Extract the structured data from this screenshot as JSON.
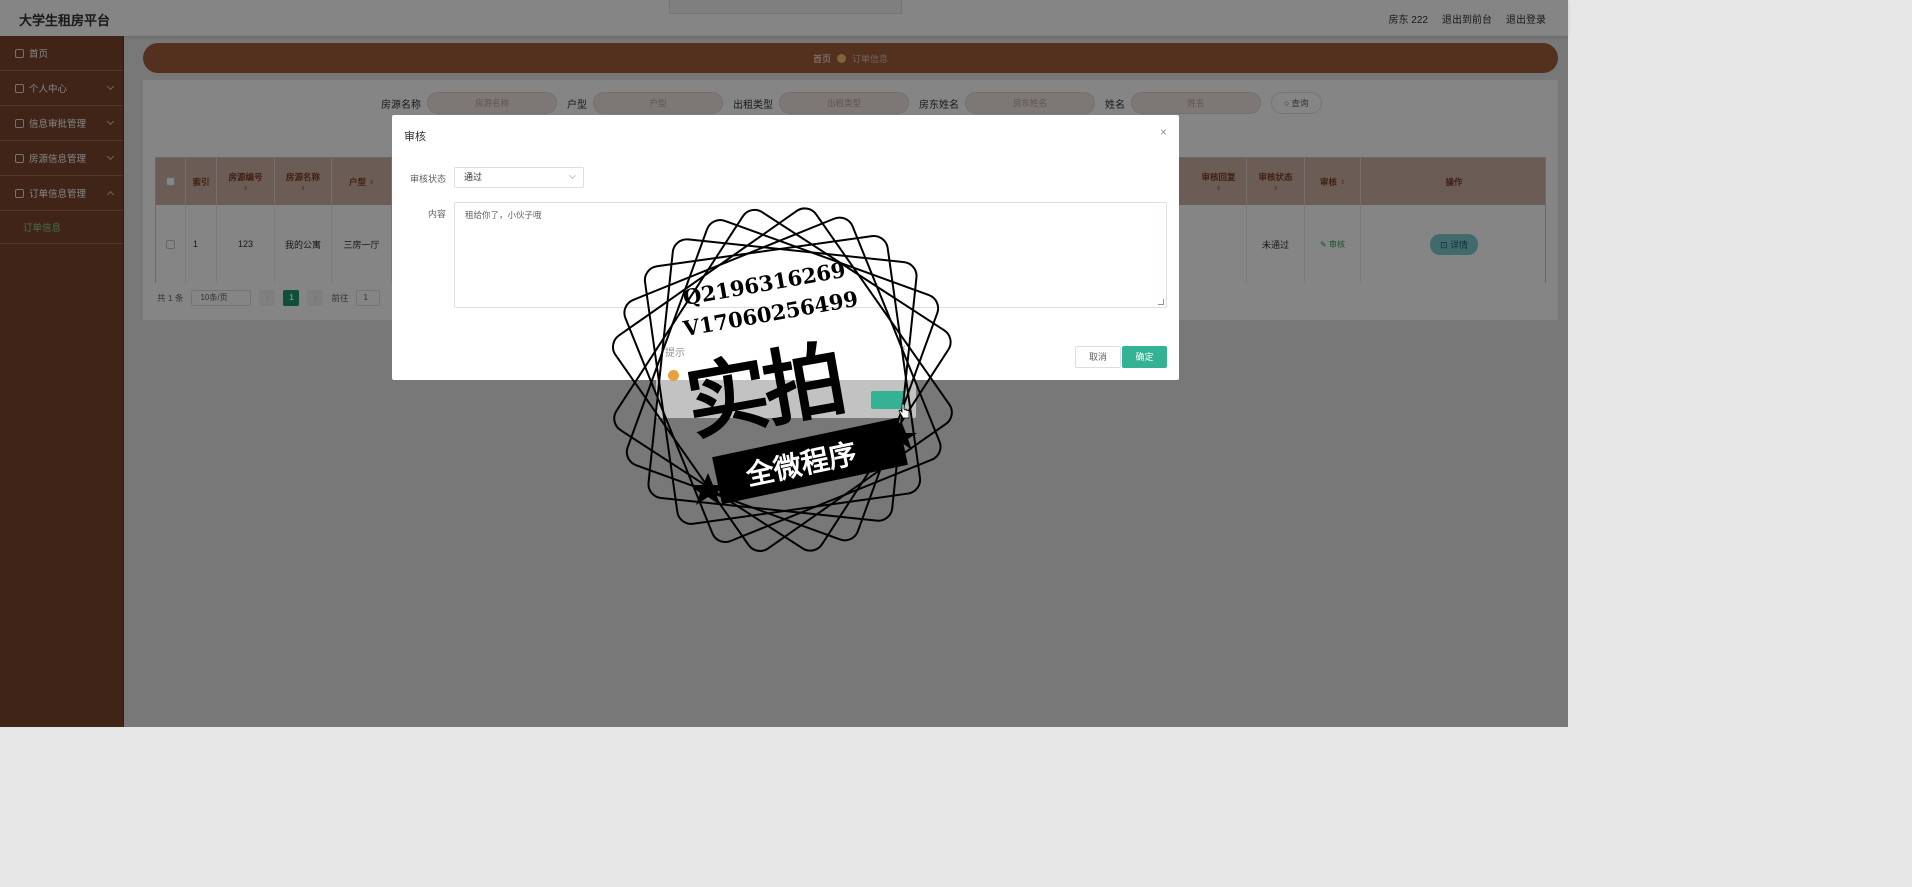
{
  "app": {
    "title": "大学生租房平台"
  },
  "topbar": {
    "user": "房东 222",
    "to_frontend": "退出到前台",
    "logout": "退出登录"
  },
  "sidebar": {
    "items": [
      {
        "label": "首页",
        "icon": "home-icon"
      },
      {
        "label": "个人中心",
        "icon": "user-icon"
      },
      {
        "label": "信息审批管理",
        "icon": "approve-icon"
      },
      {
        "label": "房源信息管理",
        "icon": "house-icon"
      },
      {
        "label": "订单信息管理",
        "icon": "order-icon"
      }
    ],
    "active_sub": "订单信息"
  },
  "breadcrumb": {
    "home": "首页",
    "current": "订单信息"
  },
  "search": {
    "fields": [
      {
        "label": "房源名称",
        "placeholder": "房源名称"
      },
      {
        "label": "户型",
        "placeholder": "户型"
      },
      {
        "label": "出租类型",
        "placeholder": "出租类型"
      },
      {
        "label": "房东姓名",
        "placeholder": "房东姓名"
      },
      {
        "label": "姓名",
        "placeholder": "姓名"
      }
    ],
    "button": "查询"
  },
  "table": {
    "columns": [
      "索引",
      "房源编号",
      "房源名称",
      "户型",
      "审核回复",
      "审核状态",
      "审核",
      "操作"
    ],
    "row": {
      "index": "1",
      "house_no": "123",
      "house_name": "我的公寓",
      "layout": "三房一厅",
      "reply": "",
      "status": "未通过",
      "audit": "审核",
      "action": "详情"
    }
  },
  "pager": {
    "total": "共 1 条",
    "page_size": "10条/页",
    "current": "1",
    "goto_label": "前往",
    "goto_value": "1"
  },
  "dialog": {
    "title": "审核",
    "status_label": "审核状态",
    "status_value": "通过",
    "content_label": "内容",
    "content_value": "租给你了，小伙子哦",
    "cancel": "取消",
    "ok": "确定"
  },
  "ghost_confirm": {
    "title": "提示"
  },
  "watermark": {
    "line1": "Q2196316269",
    "line2": "V17060256499",
    "big": "实拍",
    "band": "全微程序"
  },
  "colors": {
    "sidebar": "#7a452c",
    "breadcrumb": "#a25c3d",
    "primary": "#34b294",
    "pager_active": "#1a9a6a"
  }
}
